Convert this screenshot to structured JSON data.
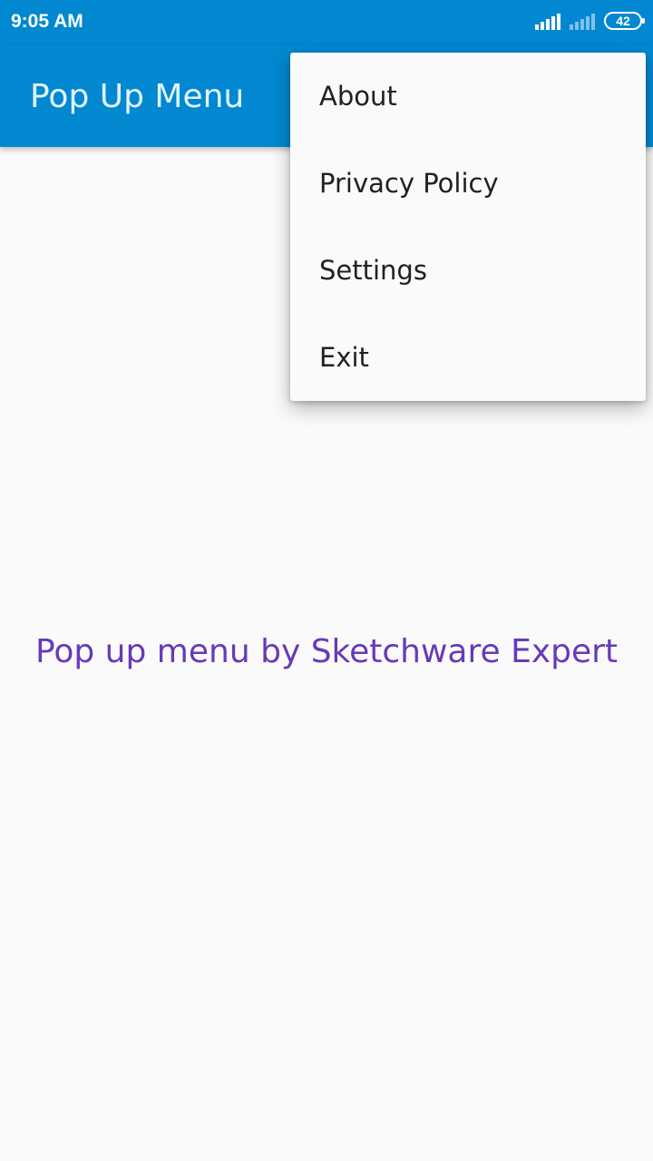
{
  "status_bar": {
    "time": "9:05 AM",
    "battery_level": "42",
    "icons": [
      "signal-icon",
      "signal-weak-icon",
      "battery-icon"
    ]
  },
  "app_bar": {
    "title": "Pop Up Menu"
  },
  "popup_menu": {
    "items": [
      "About",
      "Privacy Policy",
      "Settings",
      "Exit"
    ]
  },
  "main": {
    "text": "Pop up menu by Sketchware Expert"
  },
  "colors": {
    "primary": "#0288d1",
    "title_text": "#e1f5fe",
    "accent_text": "#673ab7",
    "background": "#fafafa"
  }
}
